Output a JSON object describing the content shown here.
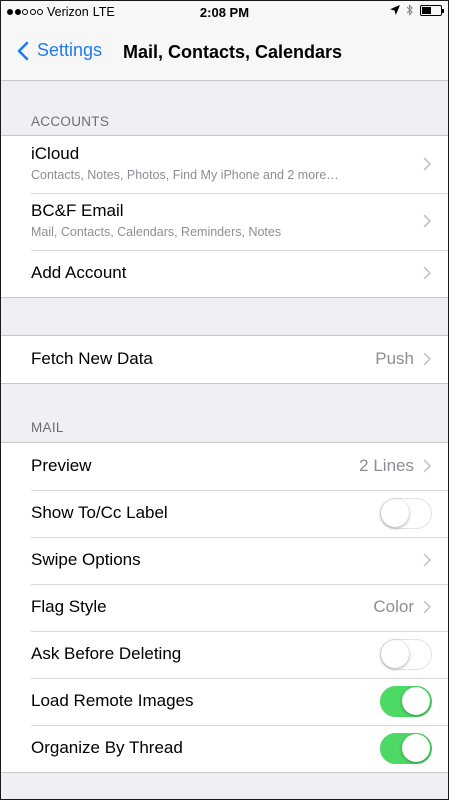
{
  "status_bar": {
    "carrier": "Verizon",
    "network": "LTE",
    "time": "2:08 PM"
  },
  "nav": {
    "back_label": "Settings",
    "title": "Mail, Contacts, Calendars"
  },
  "accounts": {
    "header": "ACCOUNTS",
    "items": [
      {
        "title": "iCloud",
        "subtitle": "Contacts, Notes, Photos, Find My iPhone and 2 more…"
      },
      {
        "title": "BC&F Email",
        "subtitle": "Mail, Contacts, Calendars, Reminders, Notes"
      },
      {
        "title": "Add Account"
      }
    ]
  },
  "fetch": {
    "title": "Fetch New Data",
    "value": "Push"
  },
  "mail": {
    "header": "MAIL",
    "preview": {
      "title": "Preview",
      "value": "2 Lines"
    },
    "show_tocc": {
      "title": "Show To/Cc Label",
      "on": false
    },
    "swipe": {
      "title": "Swipe Options"
    },
    "flag_style": {
      "title": "Flag Style",
      "value": "Color"
    },
    "ask_before_deleting": {
      "title": "Ask Before Deleting",
      "on": false
    },
    "load_remote_images": {
      "title": "Load Remote Images",
      "on": true
    },
    "organize_by_thread": {
      "title": "Organize By Thread",
      "on": true
    }
  },
  "colors": {
    "accent": "#1f7cf2",
    "toggle_on": "#4cd964",
    "background": "#efeff4"
  }
}
